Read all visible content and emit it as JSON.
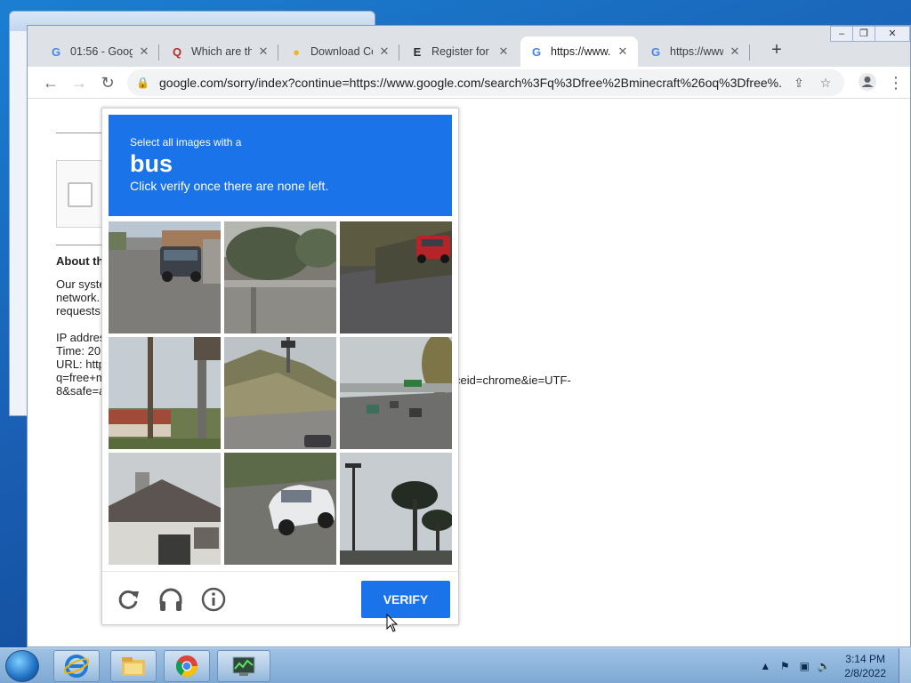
{
  "browser": {
    "tabs": [
      {
        "favicon": "google-g-icon",
        "title": "01:56 - Goog",
        "active": false
      },
      {
        "favicon": "quora-q-icon",
        "title": "Which are the",
        "active": false
      },
      {
        "favicon": "download-site-icon",
        "title": "Download Co",
        "active": false
      },
      {
        "favicon": "epic-games-icon",
        "title": "Register for a",
        "active": false
      },
      {
        "favicon": "google-g-icon",
        "title": "https://www.",
        "active": true
      },
      {
        "favicon": "google-g-icon",
        "title": "https://www.",
        "active": false
      }
    ],
    "address": "google.com/sorry/index?continue=https://www.google.com/search%3Fq%3Dfree%2Bminecraft%26oq%3Dfree%..."
  },
  "page": {
    "about_heading": "About th",
    "lines": [
      "Our syste",
      "network.",
      "requests",
      "",
      "IP addres",
      "Time: 20",
      "URL: http",
      "q=free+m",
      "8&safe=a"
    ],
    "url_tail": "ceid=chrome&ie=UTF-"
  },
  "captcha": {
    "instruction_small": "Select all images with a",
    "target_word": "bus",
    "instruction_sub": "Click verify once there are none left.",
    "tiles": [
      "suv-on-street",
      "house-and-wall",
      "red-car-on-road",
      "utility-pole-and-sign",
      "hillside-road",
      "overpass-with-traffic",
      "house-roof",
      "white-car",
      "palm-trees-and-streetlight"
    ],
    "verify_label": "VERIFY"
  },
  "taskbar": {
    "time": "3:14 PM",
    "date": "2/8/2022"
  }
}
